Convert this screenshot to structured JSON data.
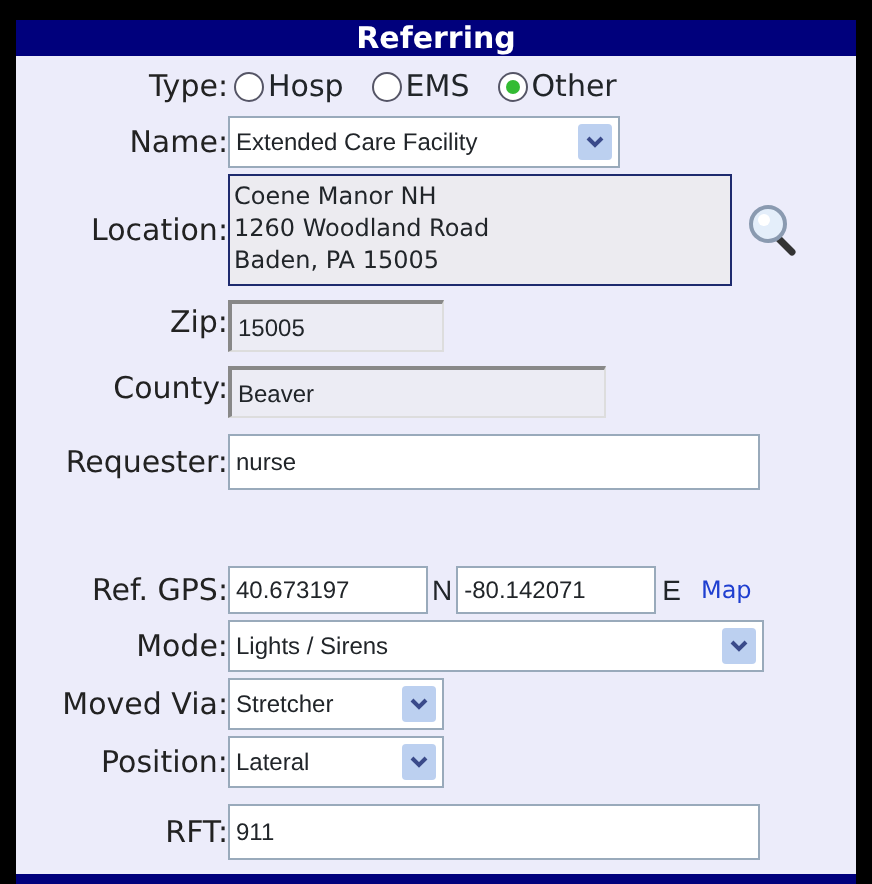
{
  "header": {
    "title": "Referring"
  },
  "rows": [
    {
      "kind": "radio",
      "label": "Type:",
      "options": [
        {
          "label": "Hosp",
          "selected": false
        },
        {
          "label": "EMS",
          "selected": false
        },
        {
          "label": "Other",
          "selected": true
        }
      ]
    },
    {
      "kind": "select",
      "label": "Name:",
      "value": "Extended Care Facility"
    },
    {
      "kind": "address",
      "label": "Location:",
      "lines": [
        "Coene Manor NH",
        "1260 Woodland Road",
        "Baden, PA 15005"
      ]
    },
    {
      "kind": "readonly",
      "label": "Zip:",
      "value": "15005"
    },
    {
      "kind": "readonly",
      "label": "County:",
      "value": "Beaver"
    },
    {
      "kind": "text",
      "label": "Requester:",
      "value": "nurse"
    },
    {
      "kind": "gap"
    },
    {
      "kind": "gps",
      "label": "Ref. GPS:",
      "lat": "40.673197",
      "lat_unit": "N",
      "lon": "-80.142071",
      "lon_unit": "E",
      "link": "Map"
    },
    {
      "kind": "select",
      "label": "Mode:",
      "value": "Lights / Sirens"
    },
    {
      "kind": "select",
      "label": "Moved Via:",
      "value": "Stretcher"
    },
    {
      "kind": "select",
      "label": "Position:",
      "value": "Lateral"
    },
    {
      "kind": "text",
      "label": "RFT:",
      "value": "911"
    }
  ]
}
